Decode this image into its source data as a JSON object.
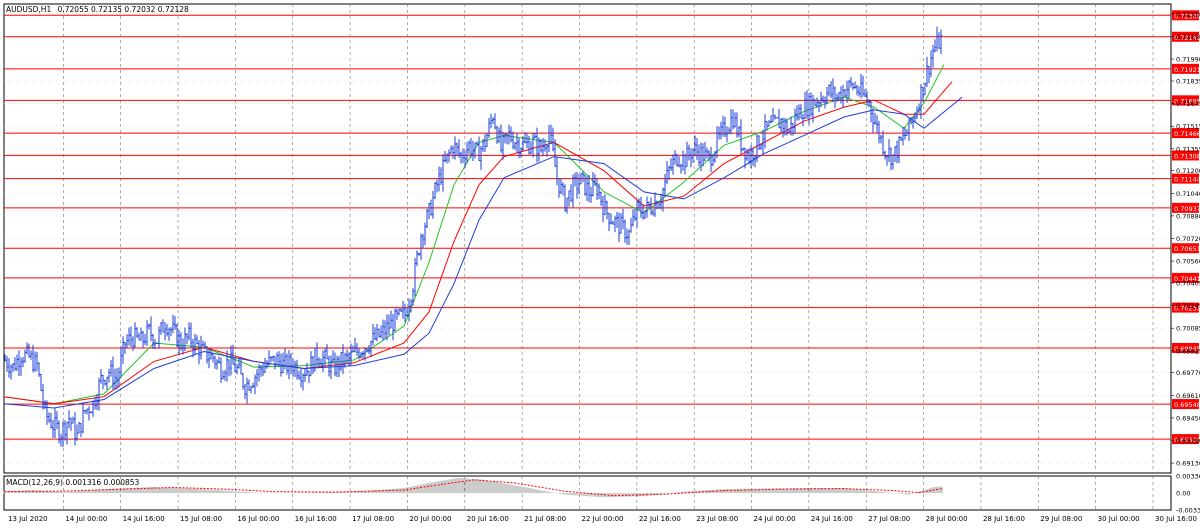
{
  "header": {
    "symbol": "AUDUSD,H1",
    "ohlc": "0.72055 0.72135 0.72032 0.72128"
  },
  "indicator": {
    "label": "MACD(12,26,9) 0.001316 0.000853"
  },
  "colors": {
    "candle": "#1d3fd6",
    "level_line": "#ff0000",
    "ma_fast": "#22c322",
    "ma_mid": "#ff0000",
    "ma_slow": "#1d3fd6",
    "grid": "#777777",
    "macd_hist": "#9a9a9a",
    "macd_signal": "#ff0000",
    "label_bg": "#ff0000"
  },
  "chart_data": {
    "type": "candlestick",
    "price_range": [
      0.6906,
      0.7238
    ],
    "grid_prices": [
      "0.72310",
      "0.72150",
      "0.71990",
      "0.71835",
      "0.71675",
      "0.71515",
      "0.71355",
      "0.71200",
      "0.71040",
      "0.70880",
      "0.70720",
      "0.70560",
      "0.70405",
      "0.70245",
      "0.70085",
      "0.69925",
      "0.69770",
      "0.69610",
      "0.69450",
      "0.69290",
      "0.69130"
    ],
    "levels": [
      "0.72300",
      "0.72148",
      "0.71921",
      "0.71698",
      "0.71466",
      "0.71308",
      "0.71144",
      "0.70937",
      "0.70651",
      "0.70441",
      "0.70231",
      "0.69945",
      "0.69548",
      "0.69300"
    ],
    "time_labels": [
      "13 Jul 2020",
      "14 Jul 00:00",
      "14 Jul 16:00",
      "15 Jul 08:00",
      "16 Jul 00:00",
      "16 Jul 16:00",
      "17 Jul 08:00",
      "20 Jul 00:00",
      "20 Jul 16:00",
      "21 Jul 08:00",
      "22 Jul 00:00",
      "22 Jul 16:00",
      "23 Jul 08:00",
      "24 Jul 00:00",
      "24 Jul 16:00",
      "27 Jul 08:00",
      "28 Jul 00:00",
      "28 Jul 16:00",
      "29 Jul 08:00",
      "30 Jul 00:00",
      "30 Jul 16:00"
    ],
    "close_path": [
      [
        0,
        0.6986
      ],
      [
        8,
        0.6981
      ],
      [
        16,
        0.699
      ],
      [
        24,
        0.6988
      ],
      [
        32,
        0.6982
      ],
      [
        40,
        0.6948
      ],
      [
        48,
        0.694
      ],
      [
        56,
        0.6935
      ],
      [
        64,
        0.6945
      ],
      [
        72,
        0.6932
      ],
      [
        80,
        0.695
      ],
      [
        88,
        0.6955
      ],
      [
        96,
        0.6972
      ],
      [
        104,
        0.6978
      ],
      [
        112,
        0.6972
      ],
      [
        120,
        0.6998
      ],
      [
        128,
        0.7002
      ],
      [
        136,
        0.6999
      ],
      [
        144,
        0.7006
      ],
      [
        152,
        0.7
      ],
      [
        160,
        0.7013
      ],
      [
        168,
        0.7006
      ],
      [
        176,
        0.6998
      ],
      [
        184,
        0.7002
      ],
      [
        192,
        0.6996
      ],
      [
        200,
        0.699
      ],
      [
        208,
        0.6988
      ],
      [
        216,
        0.698
      ],
      [
        224,
        0.6985
      ],
      [
        232,
        0.6979
      ],
      [
        240,
        0.6968
      ],
      [
        248,
        0.6973
      ],
      [
        256,
        0.698
      ],
      [
        264,
        0.6984
      ],
      [
        272,
        0.6986
      ],
      [
        280,
        0.6982
      ],
      [
        288,
        0.6983
      ],
      [
        296,
        0.6978
      ],
      [
        304,
        0.698
      ],
      [
        312,
        0.699
      ],
      [
        320,
        0.6986
      ],
      [
        328,
        0.698
      ],
      [
        336,
        0.6985
      ],
      [
        344,
        0.6987
      ],
      [
        352,
        0.6992
      ],
      [
        360,
        0.6996
      ],
      [
        368,
        0.7
      ],
      [
        376,
        0.7004
      ],
      [
        384,
        0.701
      ],
      [
        392,
        0.7015
      ],
      [
        400,
        0.7018
      ],
      [
        408,
        0.704
      ],
      [
        416,
        0.7075
      ],
      [
        424,
        0.709
      ],
      [
        432,
        0.711
      ],
      [
        440,
        0.7125
      ],
      [
        448,
        0.7138
      ],
      [
        456,
        0.713
      ],
      [
        464,
        0.7138
      ],
      [
        472,
        0.7132
      ],
      [
        480,
        0.714
      ],
      [
        488,
        0.716
      ],
      [
        496,
        0.7135
      ],
      [
        504,
        0.7145
      ],
      [
        512,
        0.714
      ],
      [
        520,
        0.7138
      ],
      [
        528,
        0.714
      ],
      [
        536,
        0.7135
      ],
      [
        544,
        0.7147
      ],
      [
        552,
        0.7115
      ],
      [
        560,
        0.7098
      ],
      [
        568,
        0.7108
      ],
      [
        576,
        0.7113
      ],
      [
        584,
        0.7105
      ],
      [
        592,
        0.7108
      ],
      [
        600,
        0.7092
      ],
      [
        608,
        0.7085
      ],
      [
        616,
        0.708
      ],
      [
        624,
        0.7075
      ],
      [
        632,
        0.7092
      ],
      [
        640,
        0.7092
      ],
      [
        648,
        0.7096
      ],
      [
        656,
        0.7102
      ],
      [
        664,
        0.712
      ],
      [
        672,
        0.713
      ],
      [
        680,
        0.7128
      ],
      [
        688,
        0.7135
      ],
      [
        696,
        0.7132
      ],
      [
        704,
        0.7128
      ],
      [
        712,
        0.714
      ],
      [
        720,
        0.715
      ],
      [
        728,
        0.7158
      ],
      [
        736,
        0.714
      ],
      [
        744,
        0.713
      ],
      [
        752,
        0.7138
      ],
      [
        760,
        0.7148
      ],
      [
        768,
        0.7152
      ],
      [
        776,
        0.7155
      ],
      [
        784,
        0.7148
      ],
      [
        792,
        0.716
      ],
      [
        800,
        0.7165
      ],
      [
        808,
        0.7168
      ],
      [
        816,
        0.7172
      ],
      [
        824,
        0.7176
      ],
      [
        832,
        0.7172
      ],
      [
        840,
        0.7178
      ],
      [
        848,
        0.718
      ],
      [
        856,
        0.7175
      ],
      [
        864,
        0.7168
      ],
      [
        872,
        0.715
      ],
      [
        880,
        0.7135
      ],
      [
        888,
        0.713
      ],
      [
        896,
        0.714
      ],
      [
        904,
        0.715
      ],
      [
        912,
        0.7165
      ],
      [
        920,
        0.7185
      ],
      [
        928,
        0.7205
      ],
      [
        936,
        0.7213
      ]
    ],
    "ma_fast": [
      [
        0,
        0.696
      ],
      [
        50,
        0.6955
      ],
      [
        100,
        0.6962
      ],
      [
        150,
        0.6998
      ],
      [
        200,
        0.6995
      ],
      [
        250,
        0.6981
      ],
      [
        300,
        0.6982
      ],
      [
        350,
        0.6986
      ],
      [
        400,
        0.701
      ],
      [
        425,
        0.7055
      ],
      [
        450,
        0.711
      ],
      [
        475,
        0.714
      ],
      [
        500,
        0.7145
      ],
      [
        550,
        0.714
      ],
      [
        600,
        0.7105
      ],
      [
        640,
        0.709
      ],
      [
        680,
        0.7112
      ],
      [
        720,
        0.7138
      ],
      [
        760,
        0.7148
      ],
      [
        800,
        0.7162
      ],
      [
        840,
        0.7172
      ],
      [
        870,
        0.7165
      ],
      [
        900,
        0.715
      ],
      [
        920,
        0.7168
      ],
      [
        940,
        0.7195
      ]
    ],
    "ma_mid": [
      [
        0,
        0.696
      ],
      [
        50,
        0.6955
      ],
      [
        100,
        0.696
      ],
      [
        150,
        0.6985
      ],
      [
        200,
        0.6995
      ],
      [
        250,
        0.6985
      ],
      [
        300,
        0.698
      ],
      [
        350,
        0.6984
      ],
      [
        400,
        0.6998
      ],
      [
        425,
        0.702
      ],
      [
        450,
        0.707
      ],
      [
        475,
        0.711
      ],
      [
        500,
        0.713
      ],
      [
        550,
        0.714
      ],
      [
        600,
        0.712
      ],
      [
        640,
        0.7095
      ],
      [
        680,
        0.7102
      ],
      [
        720,
        0.7125
      ],
      [
        760,
        0.714
      ],
      [
        800,
        0.7155
      ],
      [
        840,
        0.7165
      ],
      [
        870,
        0.717
      ],
      [
        900,
        0.716
      ],
      [
        920,
        0.716
      ],
      [
        948,
        0.7183
      ]
    ],
    "ma_slow": [
      [
        0,
        0.6955
      ],
      [
        50,
        0.6952
      ],
      [
        100,
        0.6958
      ],
      [
        150,
        0.698
      ],
      [
        200,
        0.6992
      ],
      [
        250,
        0.6985
      ],
      [
        300,
        0.698
      ],
      [
        350,
        0.6982
      ],
      [
        400,
        0.699
      ],
      [
        425,
        0.7005
      ],
      [
        450,
        0.704
      ],
      [
        475,
        0.7085
      ],
      [
        500,
        0.7115
      ],
      [
        550,
        0.713
      ],
      [
        600,
        0.7125
      ],
      [
        640,
        0.7105
      ],
      [
        680,
        0.71
      ],
      [
        720,
        0.7115
      ],
      [
        760,
        0.7132
      ],
      [
        800,
        0.7145
      ],
      [
        840,
        0.7158
      ],
      [
        870,
        0.7163
      ],
      [
        900,
        0.716
      ],
      [
        920,
        0.715
      ],
      [
        958,
        0.7172
      ]
    ],
    "macd": {
      "y_labels": [
        "0.003364",
        "0.00",
        "-0.00331"
      ],
      "hist": [
        [
          0,
          0.0004
        ],
        [
          30,
          0.0006
        ],
        [
          60,
          0.0002
        ],
        [
          100,
          0.0008
        ],
        [
          150,
          0.0012
        ],
        [
          200,
          0.0008
        ],
        [
          250,
          0.0001
        ],
        [
          300,
          0.0001
        ],
        [
          350,
          0.0003
        ],
        [
          400,
          0.001
        ],
        [
          430,
          0.0022
        ],
        [
          455,
          0.003
        ],
        [
          480,
          0.0026
        ],
        [
          520,
          0.0012
        ],
        [
          560,
          -0.0003
        ],
        [
          600,
          -0.0008
        ],
        [
          640,
          -0.0006
        ],
        [
          680,
          0.0003
        ],
        [
          720,
          0.0008
        ],
        [
          760,
          0.0009
        ],
        [
          800,
          0.001
        ],
        [
          840,
          0.001
        ],
        [
          880,
          0.0002
        ],
        [
          905,
          -0.0003
        ],
        [
          930,
          0.0012
        ],
        [
          938,
          0.0013
        ]
      ],
      "signal": [
        [
          0,
          0.0003
        ],
        [
          60,
          0.0004
        ],
        [
          120,
          0.0008
        ],
        [
          170,
          0.0011
        ],
        [
          220,
          0.0008
        ],
        [
          270,
          0.0003
        ],
        [
          330,
          0.0002
        ],
        [
          400,
          0.0006
        ],
        [
          440,
          0.0018
        ],
        [
          470,
          0.0026
        ],
        [
          510,
          0.002
        ],
        [
          560,
          0.0004
        ],
        [
          610,
          -0.0005
        ],
        [
          660,
          -0.0002
        ],
        [
          720,
          0.0005
        ],
        [
          780,
          0.0008
        ],
        [
          840,
          0.0009
        ],
        [
          890,
          0.0005
        ],
        [
          915,
          0.0001
        ],
        [
          938,
          0.0009
        ]
      ]
    }
  }
}
